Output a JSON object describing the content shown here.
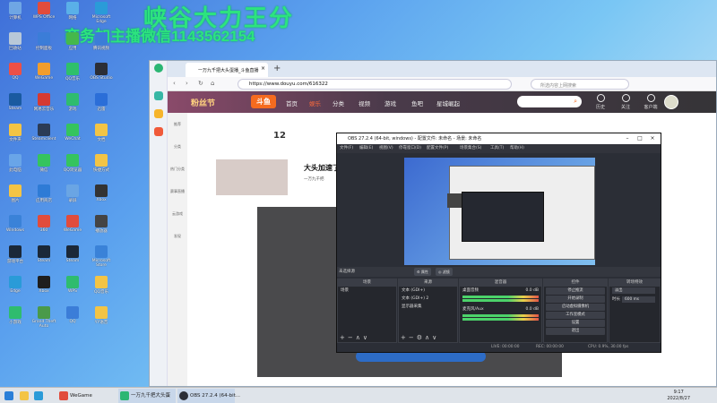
{
  "watermark": {
    "line1": "峡谷大力王分",
    "line2": "商务加主播微信1143562154"
  },
  "desktop": {
    "icons": [
      {
        "label": "计算机",
        "color": "#6fa6e4"
      },
      {
        "label": "WPS Office",
        "color": "#e14c3c"
      },
      {
        "label": "网络",
        "color": "#5ab0e8"
      },
      {
        "label": "Microsoft Edge",
        "color": "#2a9bd8"
      },
      {
        "label": "回收站",
        "color": "#b8c8d8"
      },
      {
        "label": "控制面板",
        "color": "#3b7dd8"
      },
      {
        "label": "应用",
        "color": "#45b84b"
      },
      {
        "label": "腾讯视频",
        "color": "#3b7dd8"
      },
      {
        "label": "QQ",
        "color": "#ed5046"
      },
      {
        "label": "WeGame",
        "color": "#f19d2d"
      },
      {
        "label": "QQ音乐",
        "color": "#2fc06a"
      },
      {
        "label": "OBS Studio",
        "color": "#2b2e36"
      },
      {
        "label": "Steam",
        "color": "#1a5aa0"
      },
      {
        "label": "网易云音乐",
        "color": "#d53a32"
      },
      {
        "label": "游戏",
        "color": "#2fbc6e"
      },
      {
        "label": "迅雷",
        "color": "#2b6ed8"
      },
      {
        "label": "文件夹",
        "color": "#f3c445"
      },
      {
        "label": "Steamclient",
        "color": "#2b3b55"
      },
      {
        "label": "WeChat",
        "color": "#35c45e"
      },
      {
        "label": "文档",
        "color": "#f3c445"
      },
      {
        "label": "此电脑",
        "color": "#69a5e8"
      },
      {
        "label": "微信",
        "color": "#35c45e"
      },
      {
        "label": "QQ浏览器",
        "color": "#35c45e"
      },
      {
        "label": "快捷方式",
        "color": "#f3c445"
      },
      {
        "label": "图片",
        "color": "#f3c445"
      },
      {
        "label": "应用商店",
        "color": "#2e7bd6"
      },
      {
        "label": "录屏",
        "color": "#6aa5e4"
      },
      {
        "label": "Xbox",
        "color": "#333"
      },
      {
        "label": "Windows",
        "color": "#3a82d8"
      },
      {
        "label": "360",
        "color": "#e14c3c"
      },
      {
        "label": "WeGame",
        "color": "#e14c3c"
      },
      {
        "label": "播放器",
        "color": "#444"
      },
      {
        "label": "游戏平台",
        "color": "#1b2838"
      },
      {
        "label": "Steam",
        "color": "#1b2838"
      },
      {
        "label": "Steam",
        "color": "#1b2838"
      },
      {
        "label": "Microsoft Store",
        "color": "#3a82d8"
      },
      {
        "label": "Edge",
        "color": "#2a9bd8"
      },
      {
        "label": "Xbox",
        "color": "#1e1e1e"
      },
      {
        "label": "WPS",
        "color": "#2fbc6e"
      },
      {
        "label": "QQ音乐",
        "color": "#f3c445"
      },
      {
        "label": "小游戏",
        "color": "#2fbc6e"
      },
      {
        "label": "Grand Theft Auto",
        "color": "#4a9a4a"
      },
      {
        "label": "QQ",
        "color": "#3b7dd8"
      },
      {
        "label": "YY语音",
        "color": "#f3c445"
      }
    ]
  },
  "browser": {
    "tab_title": "一万九千把大头蛋播_斗鱼直播",
    "url": "https://www.douyu.com/616322",
    "search_placeholder": "所选内容上网搜索",
    "site": {
      "logo_text": "粉丝节",
      "brand": "斗鱼",
      "nav": [
        "首页",
        "娱乐",
        "分类",
        "视频",
        "游戏",
        "鱼吧",
        "星城崛起"
      ],
      "top_icons": [
        "历史",
        "关注",
        "客户端"
      ],
      "sidebar": [
        "推荐",
        "分类",
        "热门分类",
        "赛事直播",
        "云游戏",
        "发现"
      ],
      "stat_num": "12",
      "streamer_title": "大头加速了",
      "streamer_tag": "一万九千把"
    }
  },
  "obs": {
    "title": "OBS 27.2.4 (64-bit, windows) - 配置文件: 未命名 - 场景: 未命名",
    "menu": [
      "文件(F)",
      "编辑(E)",
      "视图(V)",
      "停靠窗口(D)",
      "配置文件(P)",
      "场景集合(S)",
      "工具(T)",
      "帮助(H)"
    ],
    "scene_bar_label": "未选择源",
    "prop_btn": "属性",
    "filter_btn": "滤镜",
    "docks": {
      "scenes": {
        "title": "场景",
        "items": [
          "场景"
        ]
      },
      "sources": {
        "title": "来源",
        "items": [
          "文本 (GDI+)",
          "文本 (GDI+) 2",
          "显示器采集"
        ]
      },
      "mixer": {
        "title": "混音器",
        "tracks": [
          {
            "name": "桌面音频",
            "db": "0.0 dB"
          },
          {
            "name": "麦克风/Aux",
            "db": "0.0 dB"
          }
        ]
      },
      "controls": {
        "title": "控件",
        "buttons": [
          "停止推流",
          "开始录制",
          "启动虚拟摄像机",
          "工作室模式",
          "设置",
          "退出"
        ]
      },
      "transitions": {
        "title": "转场特效",
        "selected": "淡出",
        "duration_label": "时长",
        "duration": "600 ms"
      }
    },
    "status": {
      "live": "LIVE: 00:00:00",
      "rec": "REC: 00:00:00",
      "cpu": "CPU: 0.9%, 30.00 fps"
    }
  },
  "taskbar": {
    "items": [
      "WeGame",
      "一万九千把大头蛋",
      "OBS 27.2.4 (64-bit..."
    ],
    "time": "9:17",
    "date": "2022/8/27"
  },
  "colors": {
    "accent": "#2d6cc6",
    "douyu_orange": "#f56b1f",
    "obs_bg": "#2b2e36"
  }
}
